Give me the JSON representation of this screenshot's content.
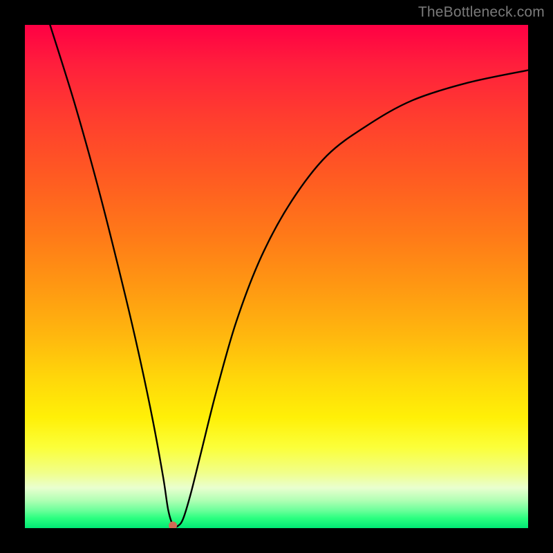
{
  "watermark": "TheBottleneck.com",
  "chart_data": {
    "type": "line",
    "title": "",
    "xlabel": "",
    "ylabel": "",
    "xlim": [
      0,
      100
    ],
    "ylim": [
      0,
      100
    ],
    "grid": false,
    "series": [
      {
        "name": "bottleneck-curve",
        "x": [
          5,
          10,
          15,
          20,
          23,
          25.5,
          27.5,
          28.5,
          29.5,
          30.5,
          31.5,
          33,
          35,
          38,
          42,
          47,
          53,
          60,
          68,
          77,
          88,
          100
        ],
        "y": [
          100,
          84,
          66,
          46,
          33,
          21,
          10,
          3.5,
          0.5,
          0.5,
          2,
          7,
          15,
          27,
          41,
          54,
          65,
          74,
          80,
          85,
          88.5,
          91
        ]
      }
    ],
    "marker": {
      "x": 29.4,
      "y": 0.5,
      "color": "#d16a55",
      "size": 6
    },
    "background": {
      "type": "linear-gradient-vertical",
      "stops": [
        {
          "pct": 0,
          "color": "#ff0044"
        },
        {
          "pct": 50,
          "color": "#ff9812"
        },
        {
          "pct": 78,
          "color": "#fff007"
        },
        {
          "pct": 92,
          "color": "#e9ffcf"
        },
        {
          "pct": 100,
          "color": "#00e874"
        }
      ]
    }
  }
}
